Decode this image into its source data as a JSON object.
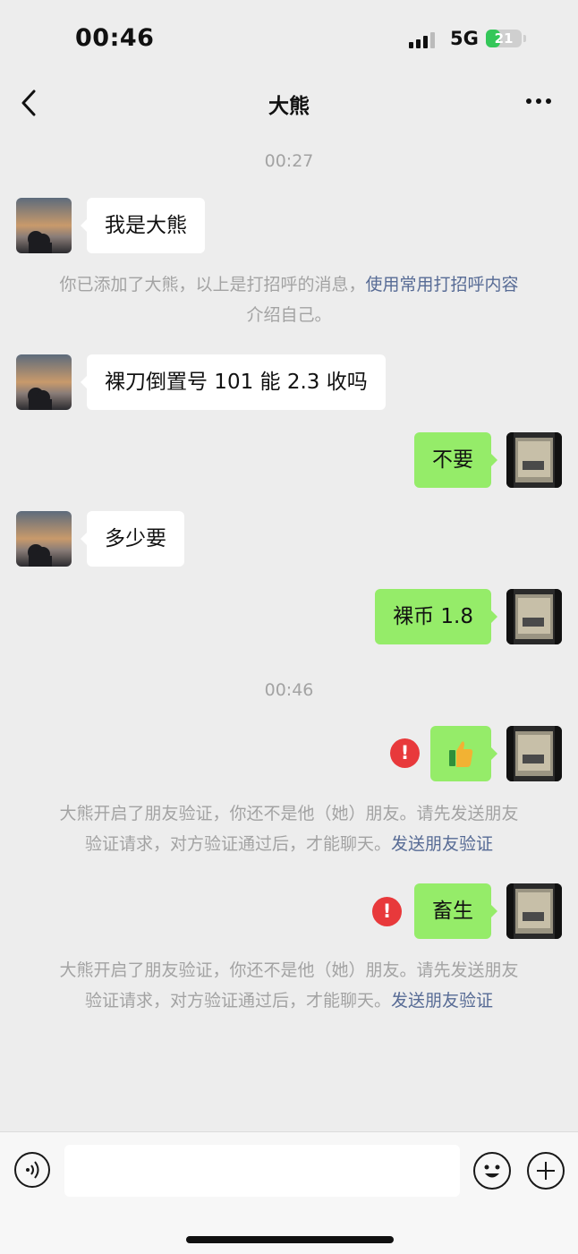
{
  "status_bar": {
    "time": "00:46",
    "network": "5G",
    "battery": "21",
    "battery_fraction": 0.21,
    "battery_color": "#34c759"
  },
  "nav": {
    "back_icon": "chevron-left-icon",
    "title": "大熊",
    "more_icon": "ellipsis-icon"
  },
  "messages": {
    "ts1": "00:27",
    "m1": "我是大熊",
    "sys1_text": "你已添加了大熊，以上是打招呼的消息，",
    "sys1_link": "使用常用打招呼内容",
    "sys1_tail": "介绍自己。",
    "m2": "裸刀倒置号 101 能 2.3 收吗",
    "m3": "不要",
    "m4": "多少要",
    "m5": "裸币 1.8",
    "ts2": "00:46",
    "m6_icon": "thumbs-up-emoji",
    "fail_mark": "!",
    "sys2_line1": "大熊开启了朋友验证，你还不是他（她）朋友。请先发送朋友",
    "sys2_line2": "验证请求，对方验证通过后，才能聊天。",
    "sys2_link": "发送朋友验证",
    "m7": "畜生",
    "sys3_line1": "大熊开启了朋友验证，你还不是他（她）朋友。请先发送朋友",
    "sys3_line2": "验证请求，对方验证通过后，才能聊天。",
    "sys3_link": "发送朋友验证"
  },
  "colors": {
    "background": "#ededed",
    "incoming_bubble": "#ffffff",
    "outgoing_bubble": "#95ec69",
    "link": "#576b95",
    "system_text": "#a3a3a3",
    "fail_badge": "#e8393b"
  },
  "input_bar": {
    "voice_icon": "voice-icon",
    "input_value": "",
    "emoji_icon": "emoji-icon",
    "plus_icon": "plus-icon"
  }
}
